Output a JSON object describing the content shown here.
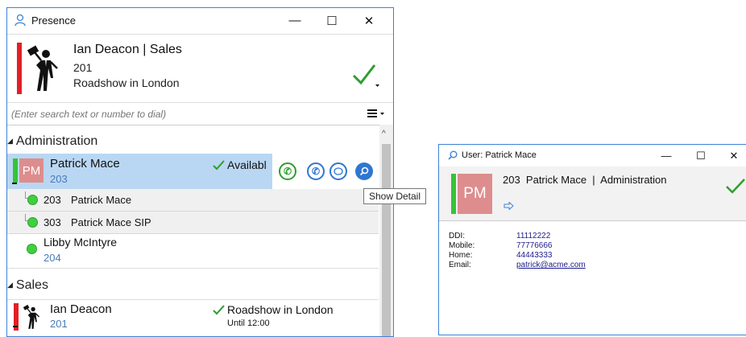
{
  "presence_window": {
    "title": "Presence",
    "controls": {
      "minimize": "—",
      "maximize": "☐",
      "close": "✕"
    },
    "current_user": {
      "name": "Ian Deacon | Sales",
      "extension": "201",
      "status": "Roadshow in London",
      "status_icon": "checkmark-icon"
    },
    "search": {
      "placeholder": "(Enter search text or number to dial)",
      "value": ""
    },
    "groups": [
      {
        "name": "Administration",
        "contacts": [
          {
            "initials": "PM",
            "name": "Patrick Mace",
            "extension": "203",
            "status": "Availabl",
            "selected": true,
            "devices": [
              {
                "number": "203",
                "name": "Patrick Mace"
              },
              {
                "number": "303",
                "name": "Patrick Mace SIP"
              }
            ]
          },
          {
            "name": "Libby McIntyre",
            "extension": "204"
          }
        ]
      },
      {
        "name": "Sales",
        "contacts": [
          {
            "name": "Ian Deacon",
            "extension": "201",
            "status": "Roadshow in London",
            "until": "Until 12:00"
          }
        ]
      }
    ],
    "tooltip": "Show Detail"
  },
  "user_window": {
    "title": "User: Patrick Mace",
    "controls": {
      "minimize": "—",
      "maximize": "☐",
      "close": "✕"
    },
    "initials": "PM",
    "header": "203  Patrick Mace  |  Administration",
    "details": [
      {
        "label": "DDI:",
        "value": "11112222"
      },
      {
        "label": "Mobile:",
        "value": "77776666"
      },
      {
        "label": "Home:",
        "value": "44443333"
      },
      {
        "label": "Email:",
        "value": "patrick@acme.com"
      }
    ]
  },
  "colors": {
    "accent": "#3c82d6",
    "available": "#37c337",
    "busy": "#e22026",
    "selection": "#b9d7f2",
    "avatar_pm": "#dd8d8d",
    "check": "#2e9e2e"
  }
}
